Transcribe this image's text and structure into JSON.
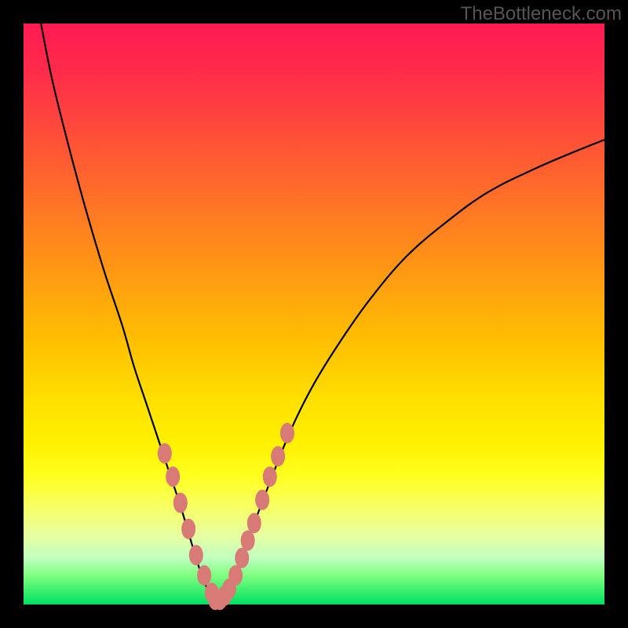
{
  "watermark": "TheBottleneck.com",
  "colors": {
    "frame": "#000000",
    "curve": "#000000",
    "marker_fill": "#d87a76",
    "marker_stroke": "#d87a76",
    "gradient_top": "#ff1a52",
    "gradient_bottom": "#00e060"
  },
  "chart_data": {
    "type": "line",
    "title": "",
    "xlabel": "",
    "ylabel": "",
    "xlim": [
      0,
      100
    ],
    "ylim": [
      0,
      100
    ],
    "grid": false,
    "legend": false,
    "annotations": [
      "TheBottleneck.com"
    ],
    "series": [
      {
        "name": "left-curve",
        "x": [
          3,
          5,
          8,
          11,
          14,
          17,
          19,
          21,
          23,
          25,
          27,
          28.5,
          30,
          31.5,
          33
        ],
        "y": [
          100,
          90,
          78,
          67,
          57,
          48,
          41,
          35,
          29,
          23,
          17,
          12,
          7,
          3,
          0.5
        ]
      },
      {
        "name": "right-curve",
        "x": [
          33,
          35,
          37,
          39,
          42,
          46,
          50,
          55,
          60,
          66,
          73,
          80,
          88,
          95,
          100
        ],
        "y": [
          0.5,
          2,
          6,
          12,
          20,
          30,
          38,
          46,
          53,
          60,
          66,
          71,
          75,
          78,
          80
        ]
      },
      {
        "name": "markers-left",
        "type": "scatter",
        "x": [
          24.3,
          25.7,
          27.0,
          28.4,
          29.7,
          31.1,
          32.4,
          33.0
        ],
        "y": [
          26.0,
          22.0,
          17.5,
          13.0,
          8.5,
          5.0,
          2.0,
          0.8
        ]
      },
      {
        "name": "markers-right",
        "type": "scatter",
        "x": [
          33.8,
          34.6,
          35.4,
          36.5,
          37.6,
          38.6,
          39.7,
          41.1,
          42.4,
          43.8,
          45.4
        ],
        "y": [
          0.8,
          1.5,
          2.7,
          5.0,
          8.0,
          11.0,
          14.0,
          18.0,
          22.0,
          25.5,
          29.5
        ]
      }
    ]
  }
}
